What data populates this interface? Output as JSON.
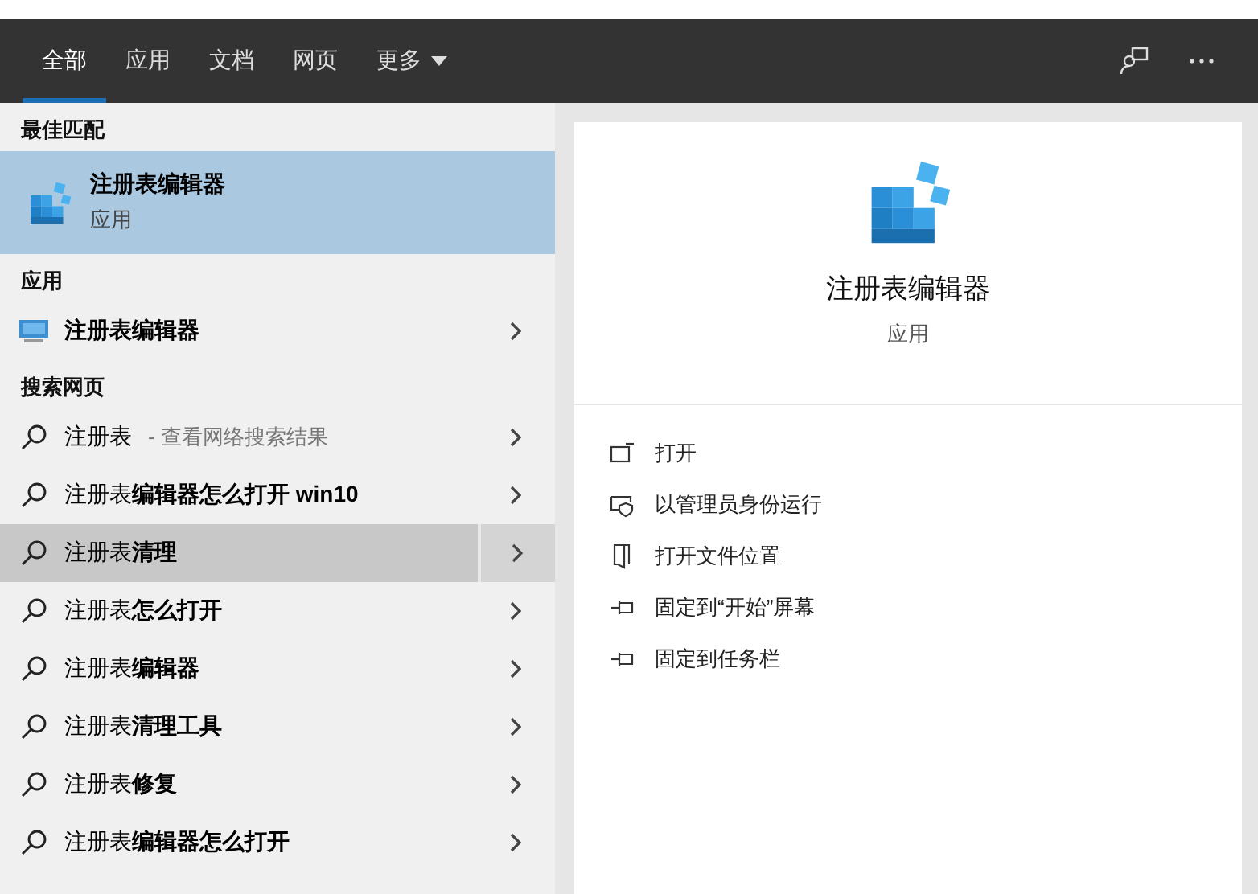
{
  "tabs": [
    {
      "label": "全部",
      "selected": true
    },
    {
      "label": "应用",
      "selected": false
    },
    {
      "label": "文档",
      "selected": false
    },
    {
      "label": "网页",
      "selected": false
    },
    {
      "label": "更多",
      "selected": false,
      "kind": "dropdown"
    }
  ],
  "best_match": {
    "heading": "最佳匹配",
    "title": "注册表编辑器",
    "subtitle": "应用",
    "selected": true
  },
  "apps": {
    "heading": "应用",
    "items": [
      {
        "label": "注册表编辑器"
      }
    ]
  },
  "web": {
    "heading": "搜索网页",
    "items": [
      {
        "label": "注册表",
        "hint": "- 查看网络搜索结果",
        "selected": false
      },
      {
        "label": "注册表**编辑器怎么打开 win10**",
        "selected": false
      },
      {
        "label": "注册表**清理**",
        "selected": true
      },
      {
        "label": "注册表**怎么打开**",
        "selected": false
      },
      {
        "label": "注册表**编辑器**",
        "selected": false
      },
      {
        "label": "注册表**清理工具**",
        "selected": false
      },
      {
        "label": "注册表**修复**",
        "selected": false
      },
      {
        "label": "注册表**编辑器怎么打开**",
        "selected": false
      }
    ]
  },
  "detail": {
    "title": "注册表编辑器",
    "subtitle": "应用",
    "actions": [
      {
        "label": "打开",
        "kind": "open"
      },
      {
        "label": "以管理员身份运行",
        "kind": "admin"
      },
      {
        "label": "打开文件位置",
        "kind": "folder"
      },
      {
        "label": "固定到“开始”屏幕",
        "kind": "pin"
      },
      {
        "label": "固定到任务栏",
        "kind": "pin"
      }
    ]
  }
}
